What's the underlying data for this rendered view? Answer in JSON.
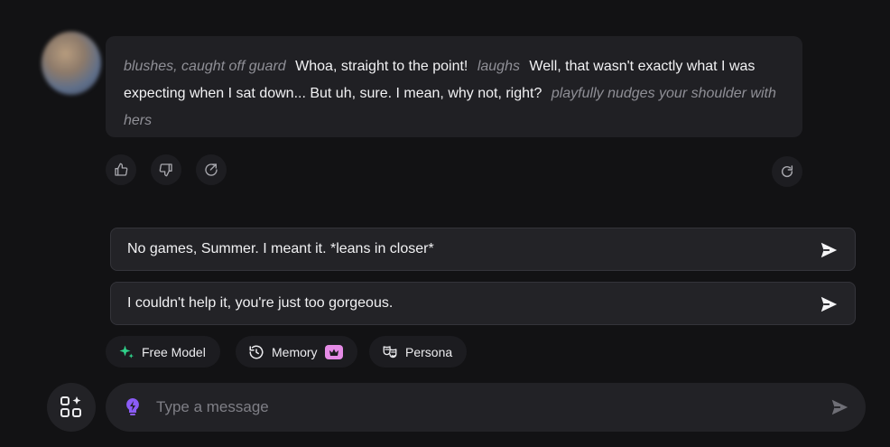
{
  "message": {
    "segments": [
      {
        "type": "action",
        "text": "blushes, caught off guard"
      },
      {
        "type": "speech",
        "text": "Whoa, straight to the point!"
      },
      {
        "type": "action",
        "text": "laughs"
      },
      {
        "type": "speech",
        "text": "Well, that wasn't exactly what I was expecting when I sat down... But uh, sure. I mean, why not, right?"
      },
      {
        "type": "action",
        "text": "playfully nudges your shoulder with hers"
      }
    ]
  },
  "message_actions": [
    "thumbs-up-icon",
    "thumbs-down-icon",
    "share-icon",
    "regenerate-icon"
  ],
  "suggestions": [
    "No games, Summer. I meant it. *leans in closer*",
    "I couldn't help it, you're just too gorgeous."
  ],
  "options": {
    "free_model": "Free Model",
    "memory": "Memory",
    "persona": "Persona"
  },
  "composer": {
    "placeholder": "Type a message"
  },
  "colors": {
    "background": "#121214",
    "bubble": "#202024",
    "action_text": "#8f8f96",
    "free_model_icon": "#2fd18a",
    "premium_badge": "#e58be6",
    "composer_icon": "#8b5cf6"
  }
}
